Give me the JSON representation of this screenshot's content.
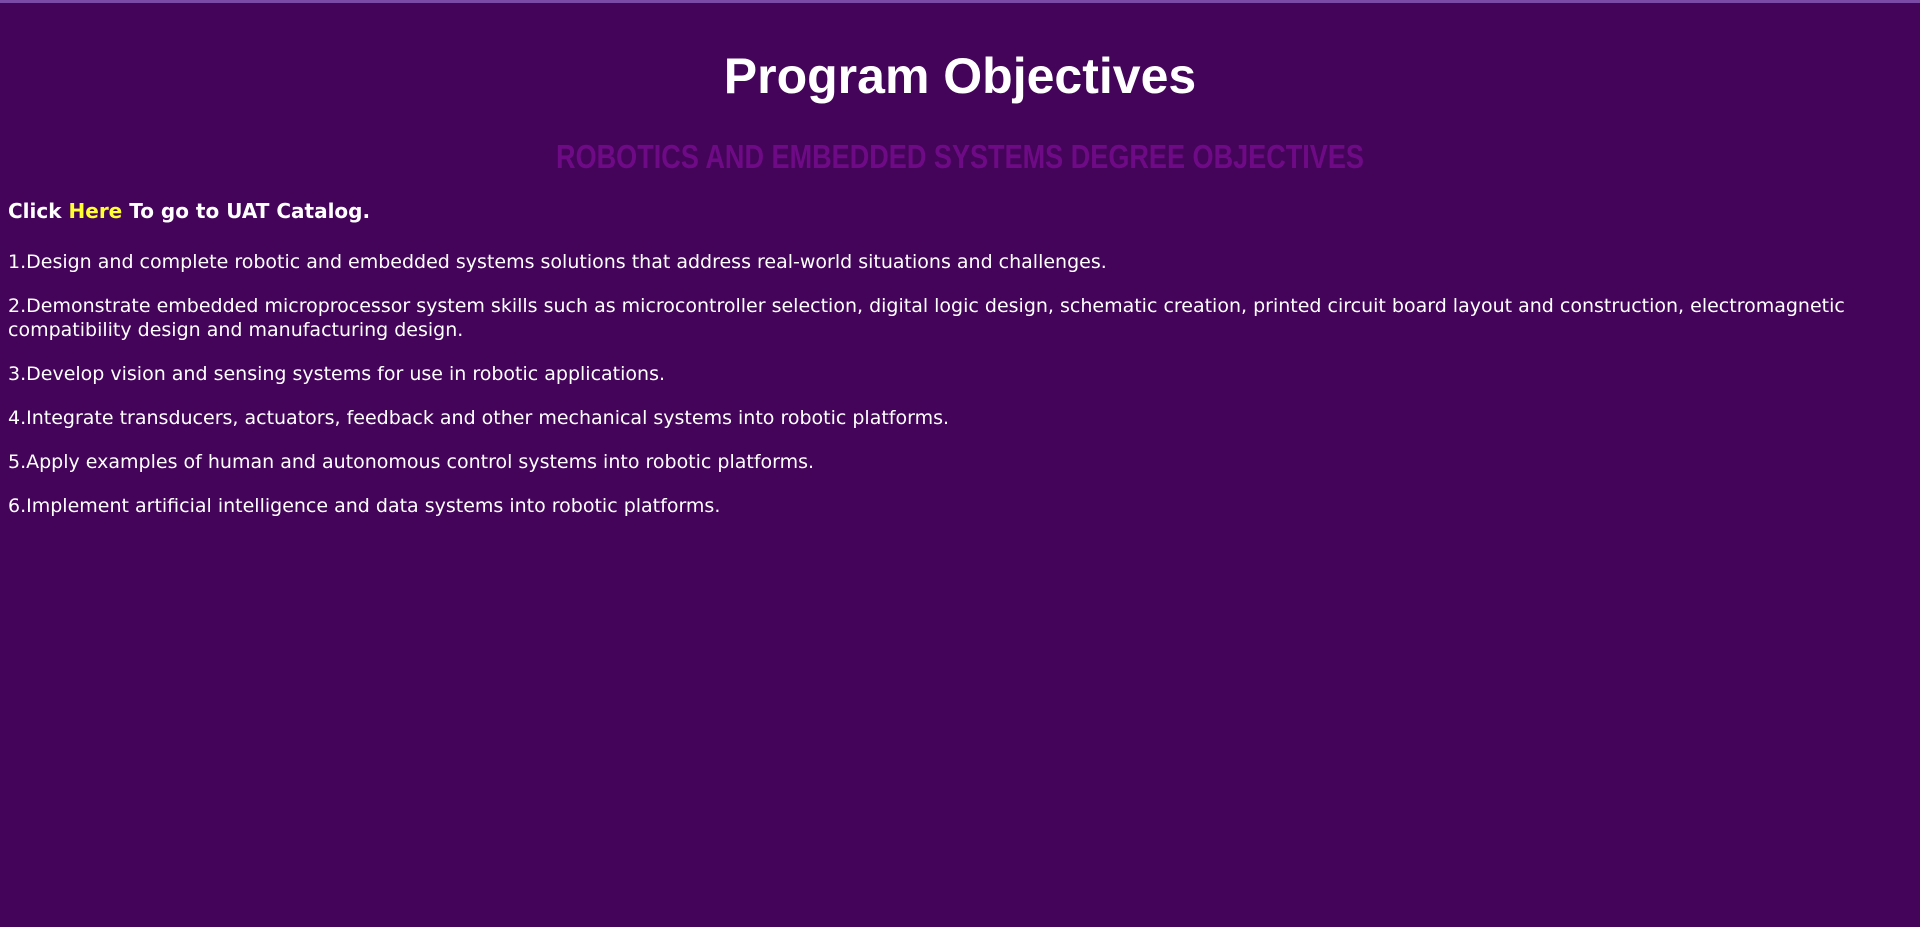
{
  "page": {
    "title": "Program Objectives",
    "degree_heading": "ROBOTICS AND EMBEDDED SYSTEMS DEGREE OBJECTIVES",
    "catalog": {
      "prefix": "Click",
      "link_label": "Here",
      "suffix": "To go to UAT Catalog."
    },
    "objectives": [
      "1.Design and complete robotic and embedded systems solutions that address real-world situations and challenges.",
      "2.Demonstrate embedded microprocessor system skills such as microcontroller selection, digital logic design, schematic creation, printed circuit board layout and construction, electromagnetic compatibility design and manufacturing design.",
      "3.Develop vision and sensing systems for use in robotic applications.",
      "4.Integrate transducers, actuators, feedback and other mechanical systems into robotic platforms.",
      "5.Apply examples of human and autonomous control systems into robotic platforms.",
      "6.Implement artificial intelligence and data systems into robotic platforms."
    ]
  },
  "colors": {
    "background": "#44045a",
    "text": "#ffffff",
    "link": "#ffff33",
    "degree_heading": "#6f0a86",
    "top_rule": "#7b4aa6"
  }
}
